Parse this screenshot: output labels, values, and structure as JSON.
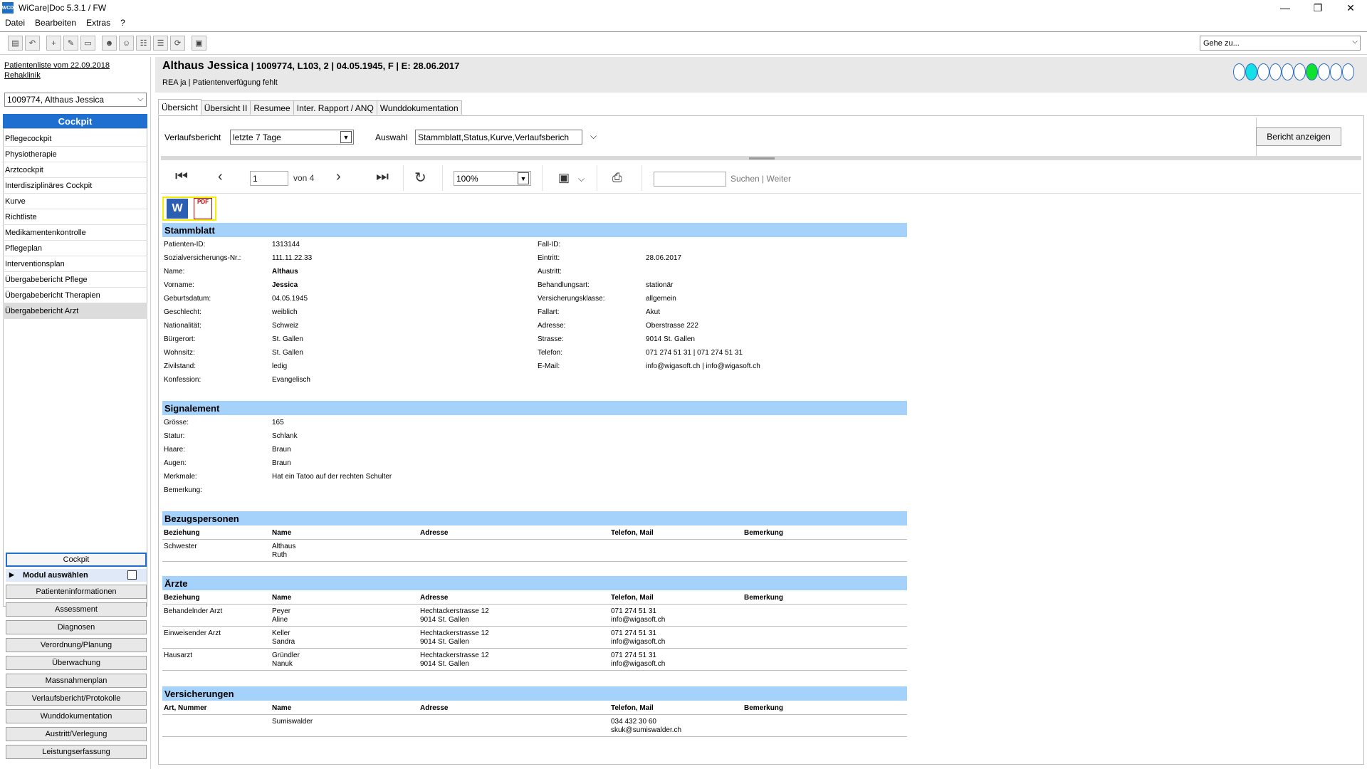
{
  "window": {
    "title": "WiCare|Doc 5.3.1  / FW",
    "app_icon_text": "WCD",
    "minimize": "—",
    "maximize": "❐",
    "close": "✕"
  },
  "menu": [
    "Datei",
    "Bearbeiten",
    "Extras",
    "?"
  ],
  "toolbar": {
    "goto_placeholder": "Gehe zu...",
    "icons": [
      "save-icon",
      "undo-icon",
      "new-icon",
      "edit-icon",
      "window-icon",
      "users-icon",
      "user-icon",
      "group-icon",
      "group-edit-icon",
      "refresh-icon",
      "info-icon"
    ]
  },
  "sidebar": {
    "patientlist_link": "Patientenliste vom 22.09.2018",
    "clinic_link": "Rehaklinik",
    "patient_select": "1009774, Althaus Jessica",
    "cockpit_header": "Cockpit",
    "nav_items": [
      "Pflegecockpit",
      "Physiotherapie",
      "Arztcockpit",
      "Interdisziplinäres Cockpit",
      "Kurve",
      "Richtliste",
      "Medikamentenkontrolle",
      "Pflegeplan",
      "Interventionsplan",
      "Übergabebericht Pflege",
      "Übergabebericht Therapien",
      "Übergabebericht Arzt"
    ],
    "active_nav": 11,
    "cockpit_button": "Cockpit",
    "module_select": "Modul auswählen",
    "module_buttons": [
      "Patienteninformationen",
      "Assessment",
      "Diagnosen",
      "Verordnung/Planung",
      "Überwachung",
      "Massnahmenplan",
      "Verlaufsbericht/Protokolle",
      "Wunddokumentation",
      "Austritt/Verlegung",
      "Leistungserfassung"
    ]
  },
  "patient": {
    "name": "Althaus Jessica",
    "details": " | 1009774, L103, 2 | 04.05.1945, F | E: 28.06.2017",
    "sub": "REA ja | Patientenverfügung fehlt",
    "status_pills": [
      "empty",
      "cyan",
      "empty",
      "empty",
      "empty",
      "empty",
      "green",
      "empty",
      "empty",
      "empty"
    ]
  },
  "tabs": [
    "Übersicht",
    "Übersicht II",
    "Resumee",
    "Inter. Rapport / ANQ",
    "Wunddokumentation"
  ],
  "params": {
    "verlauf_label": "Verlaufsbericht",
    "verlauf_value": "letzte 7 Tage",
    "auswahl_label": "Auswahl",
    "auswahl_value": "Stammblatt,Status,Kurve,Verlaufsberich",
    "report_button": "Bericht anzeigen"
  },
  "viewer": {
    "page": "1",
    "of_pages": "von 4",
    "zoom": "100%",
    "search_label": "Suchen",
    "search_sep": "|",
    "next_label": "Weiter"
  },
  "report": {
    "export_word": "W",
    "export_pdf": "PDF",
    "stammblatt": {
      "title": "Stammblatt",
      "left": [
        [
          "Patienten-ID:",
          "1313144"
        ],
        [
          "Sozialversicherungs-Nr.:",
          "111.11.22.33"
        ],
        [
          "Name:",
          "Althaus"
        ],
        [
          "Vorname:",
          "Jessica"
        ],
        [
          "Geburtsdatum:",
          "04.05.1945"
        ],
        [
          "Geschlecht:",
          "weiblich"
        ],
        [
          "Nationalität:",
          "Schweiz"
        ],
        [
          "Bürgerort:",
          "St. Gallen"
        ],
        [
          "Wohnsitz:",
          "St. Gallen"
        ],
        [
          "Zivilstand:",
          "ledig"
        ],
        [
          "Konfession:",
          "Evangelisch"
        ]
      ],
      "right": [
        [
          "Fall-ID:",
          ""
        ],
        [
          "Eintritt:",
          "28.06.2017"
        ],
        [
          "Austritt:",
          ""
        ],
        [
          "Behandlungsart:",
          "stationär"
        ],
        [
          "Versicherungsklasse:",
          "allgemein"
        ],
        [
          "Fallart:",
          "Akut"
        ],
        [
          "Adresse:",
          "Oberstrasse 222"
        ],
        [
          "Strasse:",
          "9014 St. Gallen"
        ],
        [
          "Telefon:",
          "071 274 51 31 | 071 274 51 31"
        ],
        [
          "E-Mail:",
          "info@wigasoft.ch | info@wigasoft.ch"
        ]
      ]
    },
    "signalement": {
      "title": "Signalement",
      "rows": [
        [
          "Grösse:",
          "165"
        ],
        [
          "Statur:",
          "Schlank"
        ],
        [
          "Haare:",
          "Braun"
        ],
        [
          "Augen:",
          "Braun"
        ],
        [
          "Merkmale:",
          "Hat ein Tatoo auf der rechten Schulter"
        ],
        [
          "Bemerkung:",
          ""
        ]
      ]
    },
    "bezugspersonen": {
      "title": "Bezugspersonen",
      "headers": [
        "Beziehung",
        "Name",
        "Adresse",
        "Telefon, Mail",
        "Bemerkung"
      ],
      "rows": [
        [
          "Schwester",
          "Althaus",
          "Ruth",
          "",
          "",
          "",
          ""
        ]
      ]
    },
    "aerzte": {
      "title": "Ärzte",
      "headers": [
        "Beziehung",
        "Name",
        "Adresse",
        "Telefon, Mail",
        "Bemerkung"
      ],
      "rows": [
        [
          "Behandelnder Arzt",
          "Peyer",
          "Aline",
          "Hechtackerstrasse 12",
          "9014 St. Gallen",
          "071 274 51 31",
          "info@wigasoft.ch"
        ],
        [
          "Einweisender Arzt",
          "Keller",
          "Sandra",
          "Hechtackerstrasse 12",
          "9014 St. Gallen",
          "071 274 51 31",
          "info@wigasoft.ch"
        ],
        [
          "Hausarzt",
          "Gründler",
          "Nanuk",
          "Hechtackerstrasse 12",
          "9014 St. Gallen",
          "071 274 51 31",
          "info@wigasoft.ch"
        ]
      ]
    },
    "versicherungen": {
      "title": "Versicherungen",
      "headers": [
        "Art, Nummer",
        "Name",
        "Adresse",
        "Telefon, Mail",
        "Bemerkung"
      ],
      "rows": [
        [
          "",
          "Sumiswalder",
          "",
          "",
          "",
          "034 432 30 60",
          "skuk@sumiswalder.ch"
        ]
      ]
    }
  }
}
